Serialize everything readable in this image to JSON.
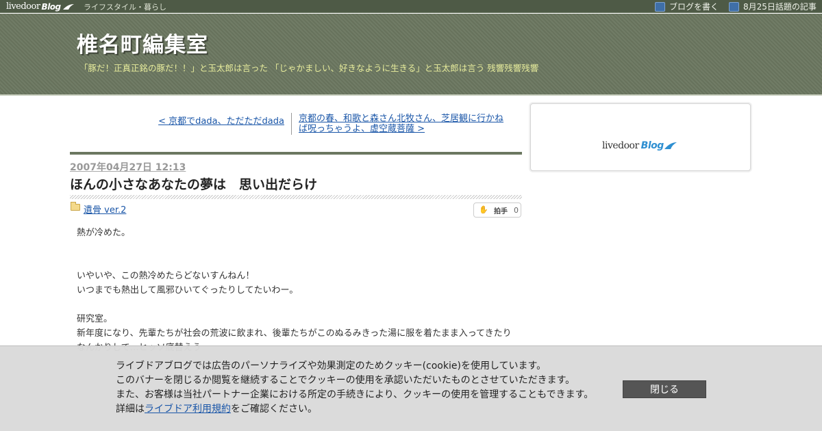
{
  "topbar": {
    "logo_text": "livedoor",
    "logo_blog": "Blog",
    "category": "ライフスタイル・暮らし",
    "write_blog": "ブログを書く",
    "topic_link": "8月25日話題の記事"
  },
  "header": {
    "title": "椎名町編集室",
    "description": "「豚だ！正真正銘の豚だ！！」と玉太郎は言った 「じゃかましい、好きなように生きる」と玉太郎は言う 残響残響残響"
  },
  "pager": {
    "prev": "< 京都でdada、ただただdada",
    "next": "京都の春、和歌と森さん北牧さん、芝居観に行かねば呪っちゃうよ、虚空蔵菩薩 >"
  },
  "post": {
    "date": "2007年04月27日 12:13",
    "title": "ほんの小さなあなたの夢は　思い出だらけ",
    "category": "遺骨 ver.2",
    "clap_label": "拍手",
    "clap_count": "0",
    "body": [
      "熱が冷めた。",
      "",
      "",
      "いやいや、この熱冷めたらどないすんねん！",
      "いつまでも熱出して風邪ひいてぐったりしてたいわー。",
      "",
      "研究室。",
      "新年度になり、先輩たちが社会の荒波に飲まれ、後輩たちがこのぬるみきった湯に服を着たまま入ってきたり",
      "なんかりして…ヒッソ底替えう"
    ]
  },
  "sidebar": {
    "logo_text": "livedoor",
    "logo_blog": "Blog"
  },
  "cookie": {
    "line1": "ライブドアブログでは広告のパーソナライズや効果測定のためクッキー(cookie)を使用しています。",
    "line2": "このバナーを閉じるか閲覧を継続することでクッキーの使用を承認いただいたものとさせていただきます。",
    "line3": "また、お客様は当社パートナー企業における所定の手続きにより、クッキーの使用を管理することもできます。",
    "line4_pre": "詳細は",
    "line4_link": "ライブドア利用規約",
    "line4_post": "をご確認ください。",
    "close": "閉じる"
  }
}
